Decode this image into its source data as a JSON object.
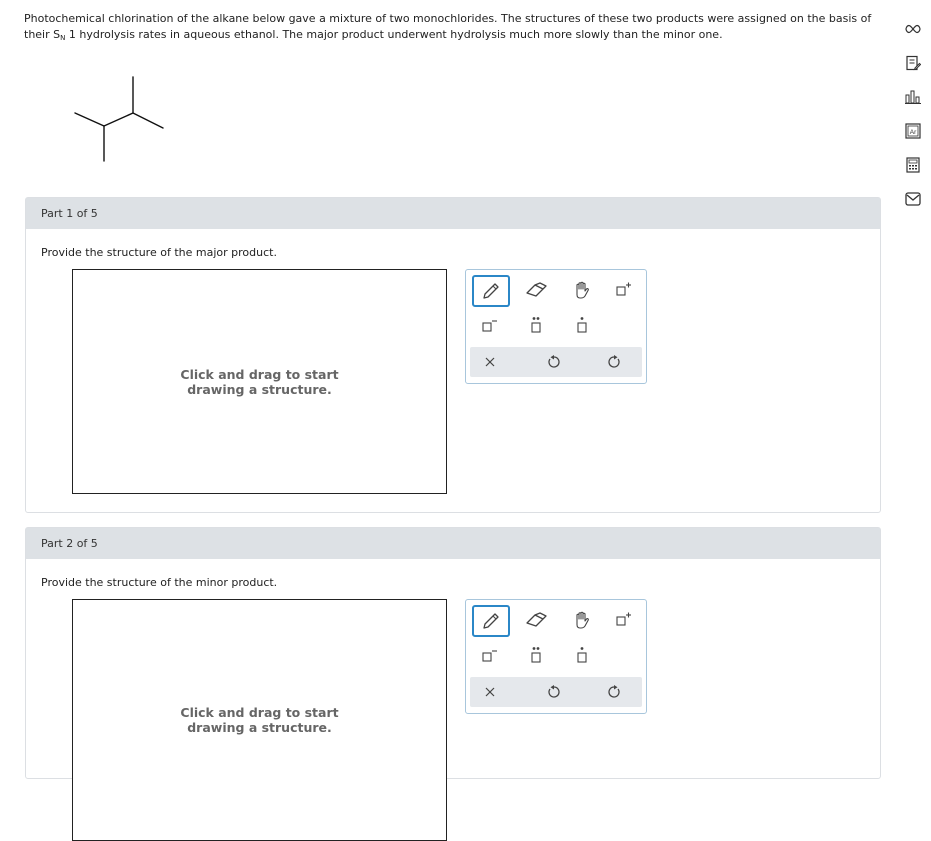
{
  "question": {
    "text_before": "Photochemical chlorination of the alkane below gave a mixture of two monochlorides. The structures of these two products were assigned on the basis of their",
    "sn_symbol": "S",
    "sn_subscript": "N",
    "text_after": "1 hydrolysis rates in aqueous ethanol. The major product underwent hydrolysis much more slowly than the minor one."
  },
  "right_rail": [
    "infinity-icon",
    "notebook-icon",
    "chart-icon",
    "periodic-table-icon",
    "calculator-icon",
    "mail-icon"
  ],
  "parts": [
    {
      "header": "Part 1 of 5",
      "prompt": "Provide the structure of the major product.",
      "canvas_hint": "Click and drag to start drawing a structure."
    },
    {
      "header": "Part 2 of 5",
      "prompt": "Provide the structure of the minor product.",
      "canvas_hint": "Click and drag to start drawing a structure."
    }
  ],
  "toolbox": {
    "tools": [
      "pencil-icon",
      "eraser-icon",
      "hand-icon",
      "add-atom-icon",
      "remove-atom-icon",
      "lone-pair-icon",
      "radical-icon",
      "clear-icon",
      "undo-icon",
      "redo-icon"
    ]
  },
  "colors": {
    "part_header_bg": "#dde1e5",
    "accent": "#2b87c7",
    "toolbox_border": "#a8c6dc"
  }
}
